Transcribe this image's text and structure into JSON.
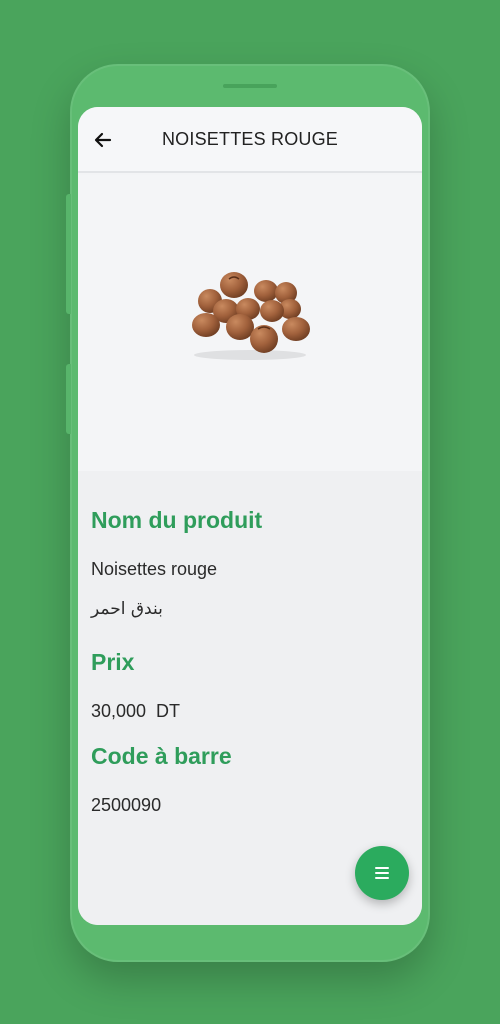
{
  "app_bar": {
    "title": "NOISETTES ROUGE",
    "back_icon": "arrow-left-icon"
  },
  "product": {
    "image_icon": "hazelnuts-image",
    "name_label": "Nom du produit",
    "name_fr": "Noisettes rouge",
    "name_ar": "بندق احمر",
    "price_label": "Prix",
    "price_value": "30,000  DT",
    "barcode_label": "Code à barre",
    "barcode_value": "2500090"
  },
  "fab": {
    "icon": "menu-icon"
  },
  "colors": {
    "background": "#4aa45c",
    "accent": "#2f9d5b",
    "fab": "#2bab5e"
  }
}
